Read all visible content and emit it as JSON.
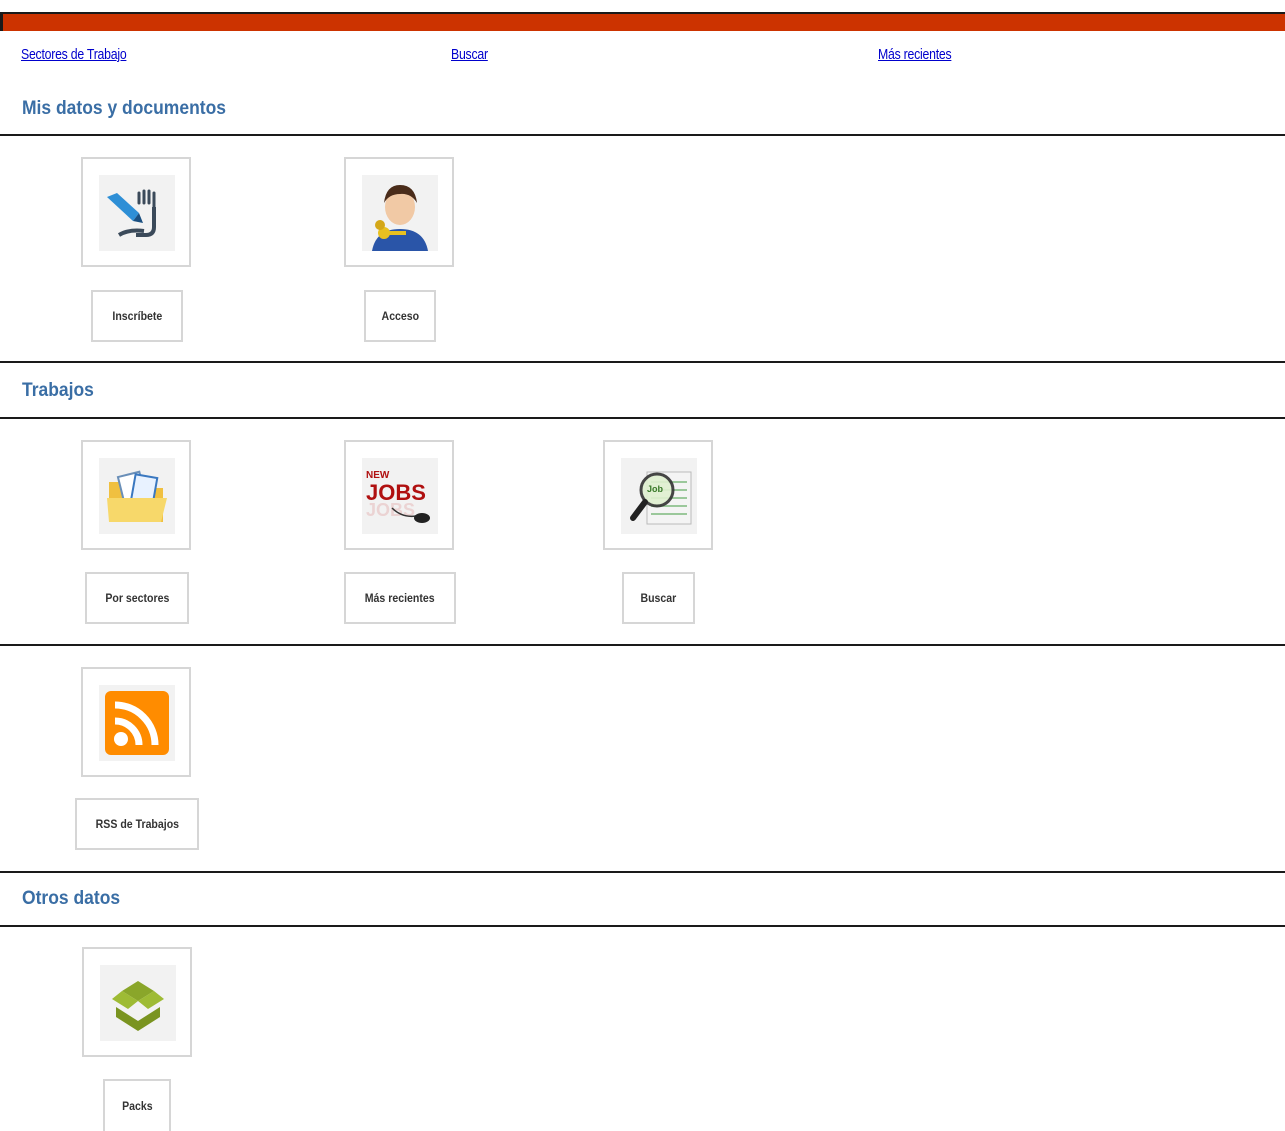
{
  "nav": {
    "sectores": "Sectores de Trabajo",
    "buscar": "Buscar",
    "recientes": "Más recientes"
  },
  "sections": {
    "mis_datos": "Mis datos y documentos",
    "trabajos": "Trabajos",
    "otros": "Otros datos"
  },
  "tiles": {
    "inscribete": "Inscríbete",
    "acceso": "Acceso",
    "por_sectores": "Por sectores",
    "mas_recientes": "Más recientes",
    "buscar": "Buscar",
    "rss": "RSS de Trabajos",
    "packs": "Packs"
  },
  "icons": {
    "inscribete": "signature-pen-icon",
    "acceso": "user-key-icon",
    "por_sectores": "folder-documents-icon",
    "mas_recientes": "new-jobs-icon",
    "buscar": "job-search-magnifier-icon",
    "rss": "rss-feed-icon",
    "packs": "box-packs-icon"
  },
  "colors": {
    "accent_bar": "#cc3300",
    "section_title": "#3a6ea5",
    "link": "#0000cc",
    "rss": "#ff8c00",
    "packs": "#8aa62a"
  }
}
